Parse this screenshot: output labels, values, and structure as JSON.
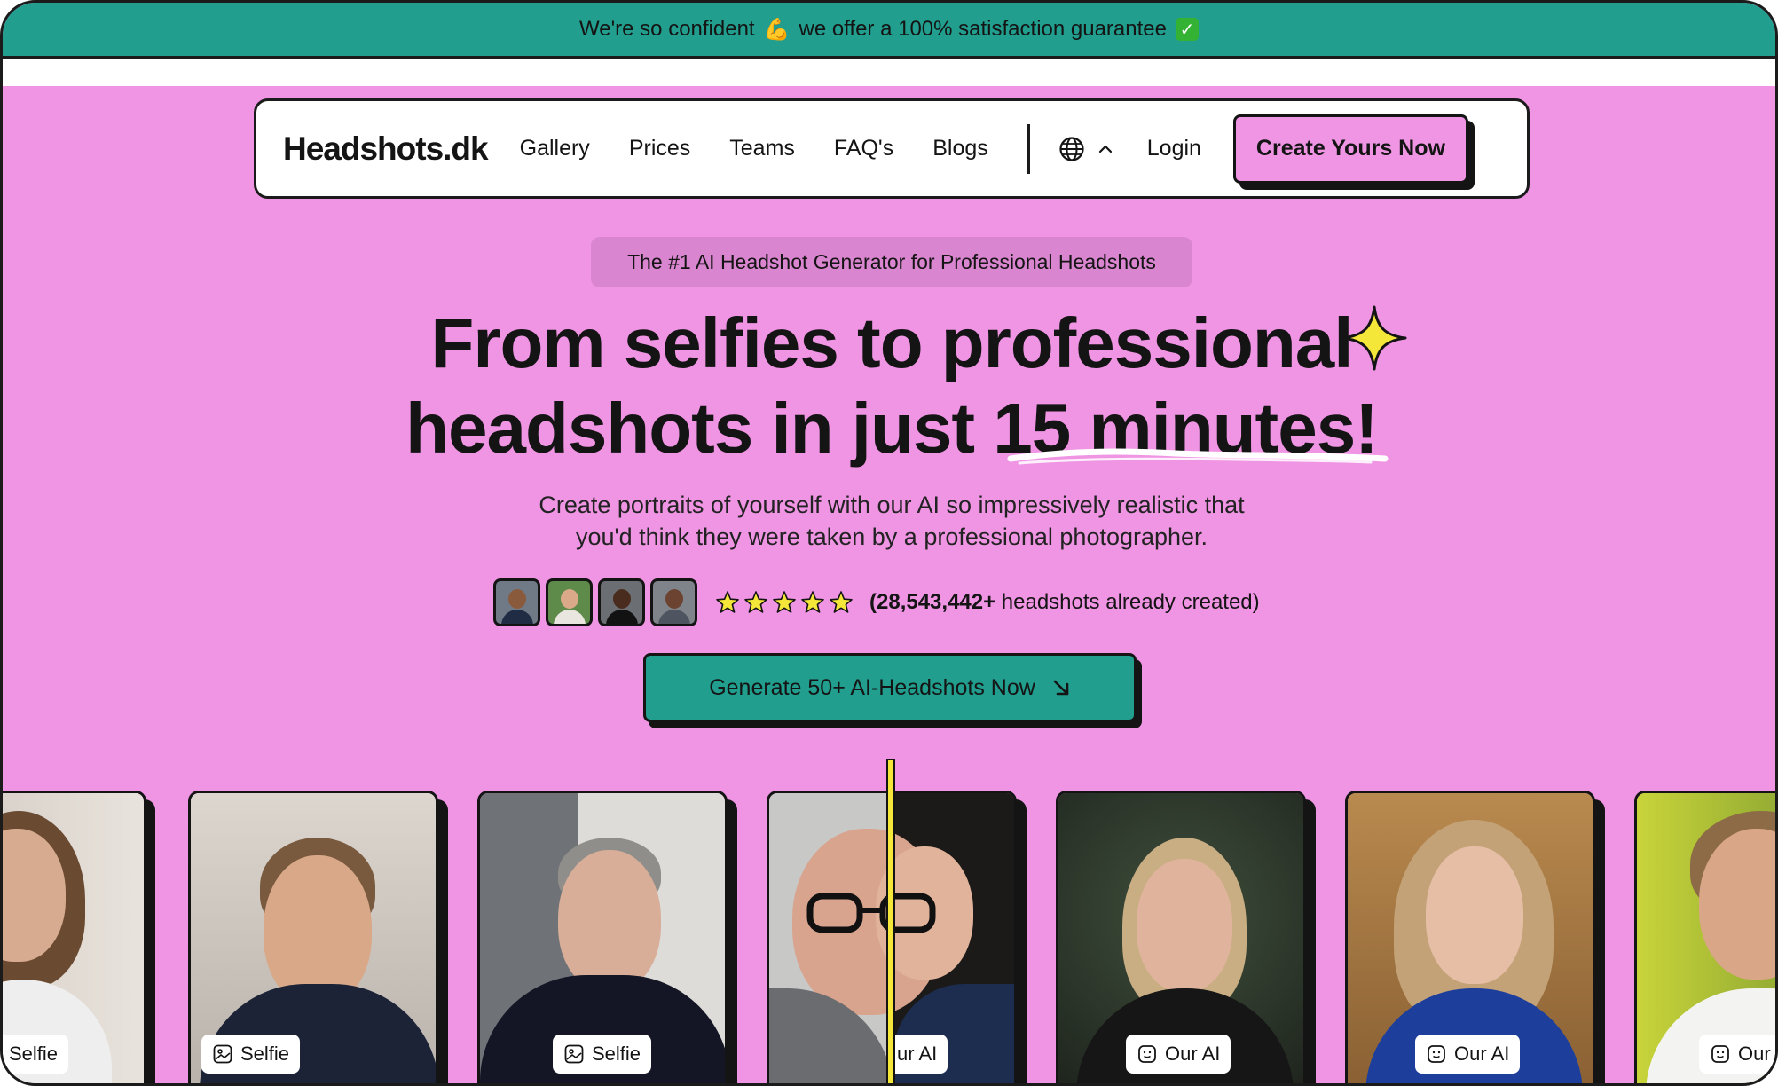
{
  "announcement": {
    "text_before": "We're so confident",
    "emoji": "💪",
    "text_after": "we offer a 100% satisfaction guarantee",
    "check": "✓"
  },
  "nav": {
    "logo": "Headshots.dk",
    "links": [
      "Gallery",
      "Prices",
      "Teams",
      "FAQ's",
      "Blogs"
    ],
    "language_icon": "globe-icon",
    "login": "Login",
    "cta": "Create Yours Now"
  },
  "hero": {
    "pill": "The #1 AI Headshot Generator for Professional Headshots",
    "headline_line1": "From selfies to professional",
    "headline_line2": "headshots in just 15 minutes!",
    "subtext_line1": "Create portraits of yourself with our AI so impressively realistic that",
    "subtext_line2": "you'd think they were taken by a professional photographer.",
    "rating_stars": 5,
    "count_number": "(28,543,442+",
    "count_suffix": " headshots already created)",
    "generate_button": "Generate 50+ AI-Headshots Now"
  },
  "gallery": {
    "labels": [
      "Selfie",
      "Selfie",
      "Selfie",
      "ur AI",
      "Our AI",
      "Our AI",
      "Our"
    ]
  },
  "colors": {
    "background": "#f095e4",
    "teal": "#219e8e",
    "pill": "#d985cf",
    "star": "#f5e63a",
    "dark": "#141414"
  }
}
